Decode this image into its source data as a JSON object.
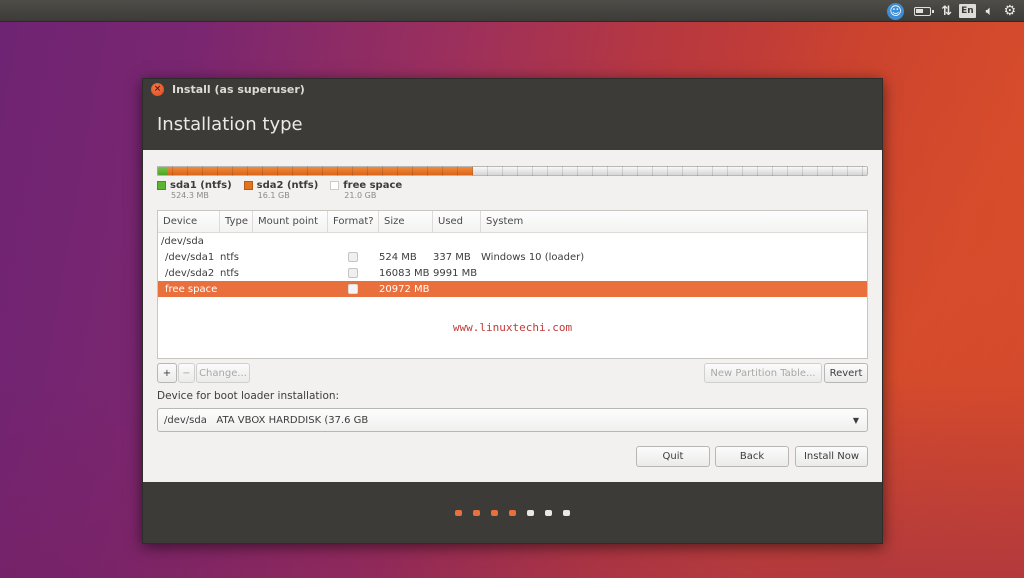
{
  "top_panel": {
    "indicators": [
      {
        "name": "accessibility-icon",
        "glyph": "✦"
      },
      {
        "name": "battery-icon",
        "glyph": ""
      },
      {
        "name": "network-icon",
        "glyph": "⇅"
      },
      {
        "name": "keyboard-layout",
        "glyph": "En"
      },
      {
        "name": "volume-icon",
        "glyph": "◂))"
      },
      {
        "name": "gear-icon",
        "glyph": "⚙"
      }
    ]
  },
  "window": {
    "title": "Install (as superuser)",
    "close_glyph": "×",
    "page_title": "Installation type"
  },
  "partition_bar": {
    "segments": [
      {
        "name": "sda1",
        "fraction": 0.014,
        "color": "#5cb532"
      },
      {
        "name": "sda2",
        "fraction": 0.43,
        "color": "#e2731f"
      },
      {
        "name": "free",
        "fraction": 0.556,
        "color": "#e6e6e6"
      }
    ]
  },
  "legend": [
    {
      "label": "sda1 (ntfs)",
      "size": "524.3 MB",
      "color": "#5cb532"
    },
    {
      "label": "sda2 (ntfs)",
      "size": "16.1 GB",
      "color": "#e2731f"
    },
    {
      "label": "free space",
      "size": "21.0 GB",
      "color": "#ffffff"
    }
  ],
  "table": {
    "columns": [
      "Device",
      "Type",
      "Mount point",
      "Format?",
      "Size",
      "Used",
      "System"
    ],
    "rows": [
      {
        "device": "/dev/sda",
        "type": "",
        "mount": "",
        "format": false,
        "size": "",
        "used": "",
        "system": "",
        "has_checkbox": false
      },
      {
        "device": "/dev/sda1",
        "type": "ntfs",
        "mount": "",
        "format": false,
        "size": "524 MB",
        "used": "337 MB",
        "system": "Windows 10 (loader)",
        "has_checkbox": true
      },
      {
        "device": "/dev/sda2",
        "type": "ntfs",
        "mount": "",
        "format": false,
        "size": "16083 MB",
        "used": "9991 MB",
        "system": "",
        "has_checkbox": true
      },
      {
        "device": "free space",
        "type": "",
        "mount": "",
        "format": false,
        "size": "20972 MB",
        "used": "",
        "system": "",
        "has_checkbox": true,
        "selected": true
      }
    ],
    "watermark": "www.linuxtechi.com"
  },
  "partition_buttons": {
    "add": "+",
    "remove": "−",
    "change": "Change...",
    "new_table": "New Partition Table...",
    "revert": "Revert"
  },
  "boot_loader": {
    "label": "Device for boot loader installation:",
    "selected": "/dev/sda   ATA VBOX HARDDISK (37.6 GB",
    "arrow": "▼"
  },
  "actions": {
    "quit": "Quit",
    "back": "Back",
    "install": "Install Now"
  },
  "progress": {
    "completed_steps": 4,
    "total_steps": 7
  }
}
